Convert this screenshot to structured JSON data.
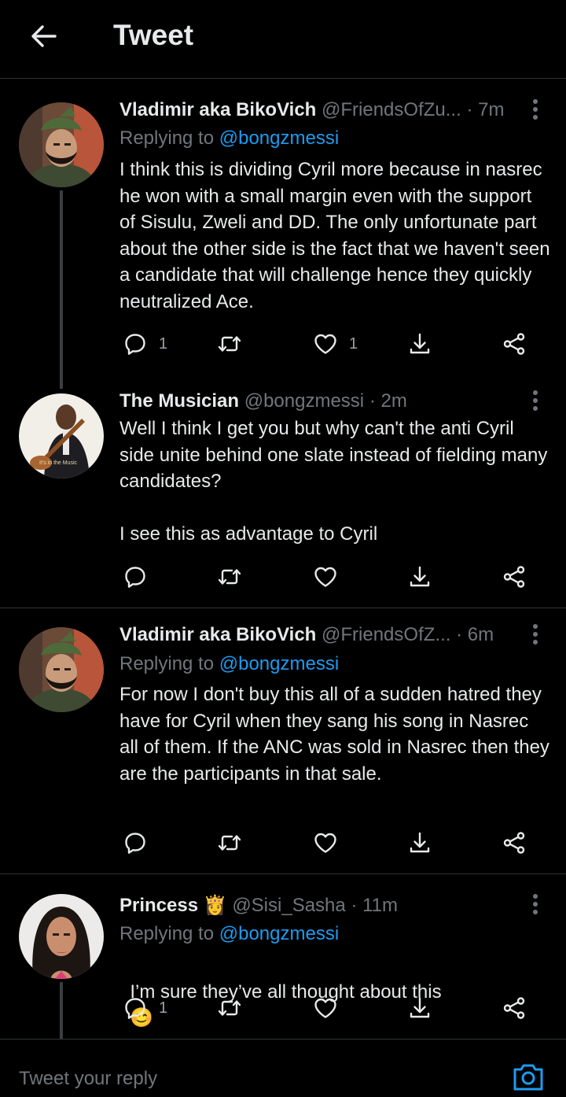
{
  "header": {
    "title": "Tweet"
  },
  "tweets": [
    {
      "name": "Vladimir aka BikoVich",
      "handle": "@FriendsOfZu...",
      "dot": "·",
      "time": "7m",
      "replying_prefix": "Replying to ",
      "replying_to": "@bongzmessi",
      "text": "I think this is dividing Cyril more because in nasrec he won with a small margin even with the support of Sisulu, Zweli and DD. The only unfortunate part about the other side is the fact that we haven't seen a candidate that will challenge hence they quickly neutralized Ace.",
      "reply_count": "1",
      "like_count": "1"
    },
    {
      "name": "The Musician",
      "handle": "@bongzmessi",
      "dot": "·",
      "time": "2m",
      "avatar_caption": "It's in the Music",
      "text": "Well I think I get you but why can't the anti Cyril side unite behind one slate instead of fielding many candidates?\n\nI see this as advantage to Cyril"
    },
    {
      "name": "Vladimir aka BikoVich",
      "handle": "@FriendsOfZ...",
      "dot": "·",
      "time": "6m",
      "replying_prefix": "Replying to ",
      "replying_to": "@bongzmessi",
      "text": "For now I don't buy this all of a sudden hatred they have for Cyril when they sang his song in Nasrec all of them. If the ANC was sold in Nasrec then they are the participants in that sale."
    },
    {
      "name": "Princess",
      "name_emoji": "👸",
      "handle": "@Sisi_Sasha",
      "dot": "·",
      "time": "11m",
      "replying_prefix": "Replying to ",
      "replying_to": "@bongzmessi",
      "text": "I’m sure they’ve all thought about this",
      "text_emoji": "😊",
      "reply_count": "1"
    }
  ],
  "reply_bar": {
    "placeholder": "Tweet your reply"
  },
  "icons": {
    "back": "arrow-left-icon",
    "reply": "reply-icon",
    "retweet": "retweet-icon",
    "like": "heart-icon",
    "download": "download-icon",
    "share": "share-icon",
    "more": "more-vertical-icon",
    "camera": "camera-icon"
  },
  "colors": {
    "background": "#000000",
    "text": "#e7e9ea",
    "secondary": "#71767b",
    "accent": "#1d9bf0",
    "divider": "#2f3336"
  }
}
